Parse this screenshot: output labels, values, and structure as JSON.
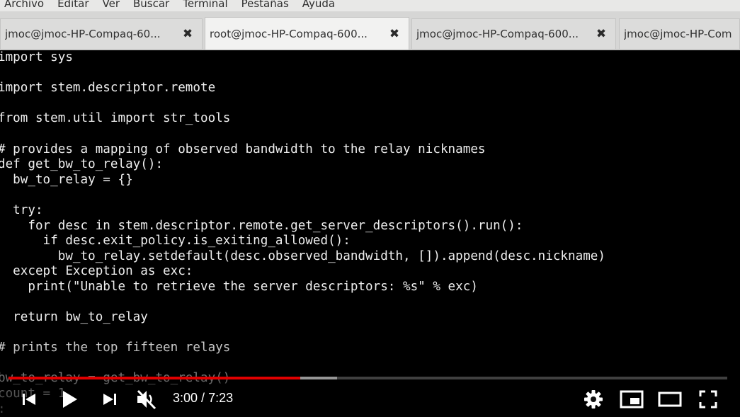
{
  "menubar": {
    "items": [
      "Archivo",
      "Editar",
      "Ver",
      "Buscar",
      "Terminal",
      "Pestañas",
      "Ayuda"
    ]
  },
  "tabs": [
    {
      "label": "jmoc@jmoc-HP-Compaq-60...",
      "close": "✖",
      "active": false
    },
    {
      "label": "root@jmoc-HP-Compaq-600...",
      "close": "✖",
      "active": true
    },
    {
      "label": "jmoc@jmoc-HP-Compaq-600...",
      "close": "✖",
      "active": false
    },
    {
      "label": "jmoc@jmoc-HP-Com",
      "active": false
    }
  ],
  "terminal": {
    "lines": [
      "import sys",
      "",
      "import stem.descriptor.remote",
      "",
      "from stem.util import str_tools",
      "",
      "# provides a mapping of observed bandwidth to the relay nicknames",
      "def get_bw_to_relay():",
      "  bw_to_relay = {}",
      "",
      "  try:",
      "    for desc in stem.descriptor.remote.get_server_descriptors().run():",
      "      if desc.exit_policy.is_exiting_allowed():",
      "        bw_to_relay.setdefault(desc.observed_bandwidth, []).append(desc.nickname)",
      "  except Exception as exc:",
      "    print(\"Unable to retrieve the server descriptors: %s\" % exc)",
      "",
      "  return bw_to_relay",
      "",
      "# prints the top fifteen relays",
      "",
      "bw_to_relay = get_bw_to_relay()",
      "count = 1",
      ":"
    ],
    "text_color": "#eeeeee",
    "background": "#000000"
  },
  "player": {
    "current_time": "3:00",
    "separator": " / ",
    "duration": "7:23",
    "played_fraction": 0.406,
    "buffered_fraction": 0.457,
    "progress_color": "#e00000",
    "icons": [
      "previous-icon",
      "play-icon",
      "next-icon",
      "mute-icon",
      "settings-icon",
      "miniplayer-icon",
      "theater-mode-icon",
      "fullscreen-icon"
    ]
  }
}
